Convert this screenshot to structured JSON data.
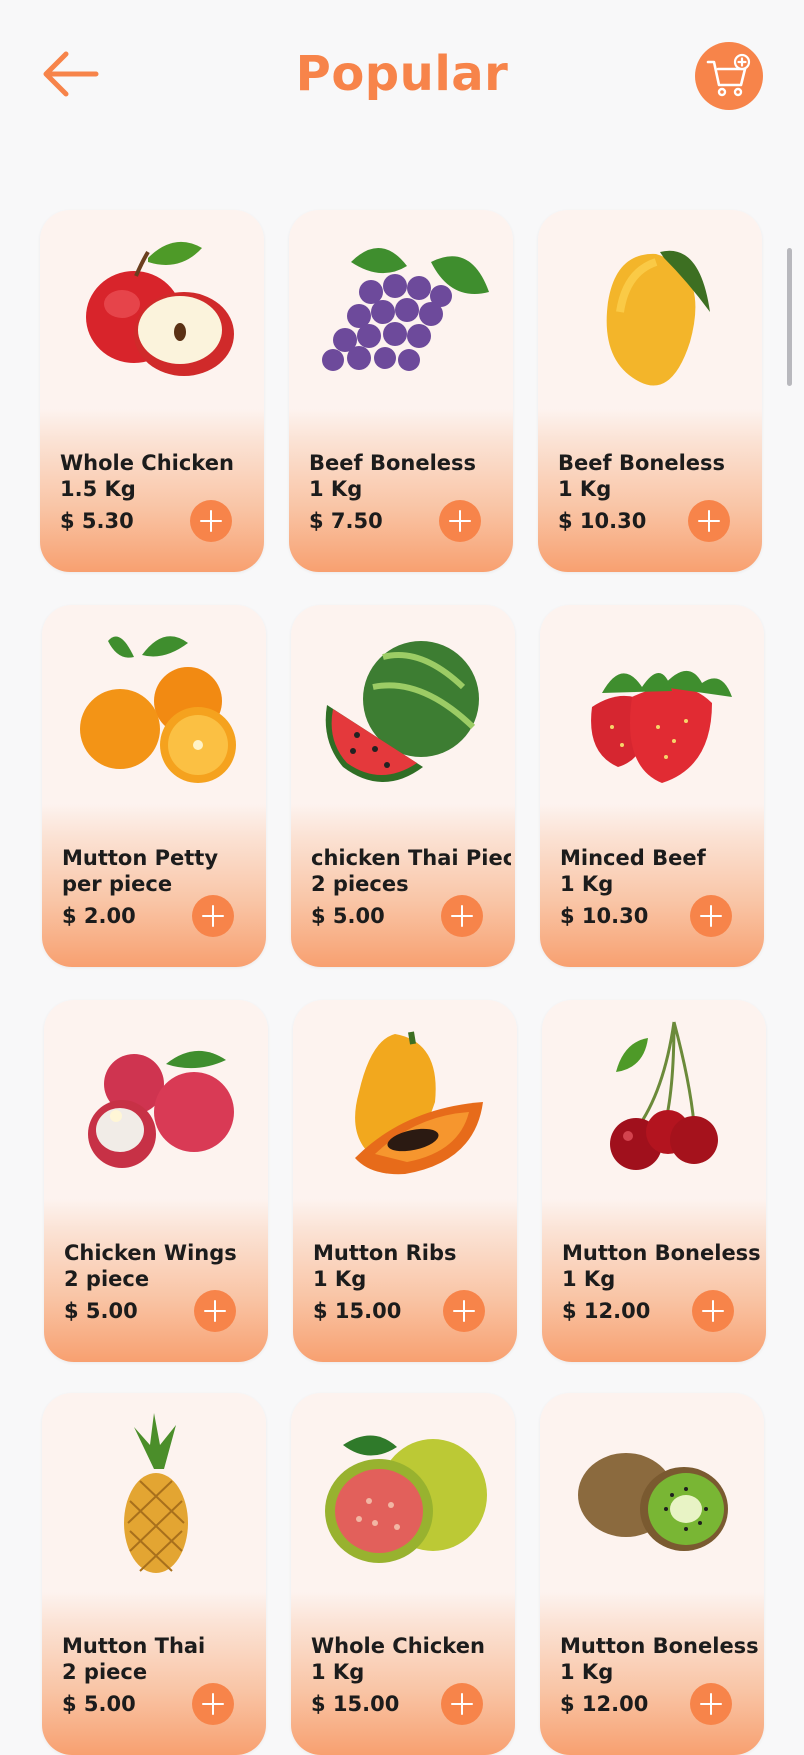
{
  "header": {
    "title": "Popular",
    "back_icon": "arrow-left-icon",
    "cart_icon": "cart-add-icon"
  },
  "colors": {
    "accent": "#f7844a",
    "card_bg": "#fdf3ef",
    "text": "#1c1c1c"
  },
  "products": [
    {
      "name": "Whole Chicken",
      "qty": "1.5 Kg",
      "price": "$ 5.30",
      "image": "apple"
    },
    {
      "name": "Beef Boneless",
      "qty": "1 Kg",
      "price": "$ 7.50",
      "image": "grapes"
    },
    {
      "name": "Beef Boneless",
      "qty": "1 Kg",
      "price": "$ 10.30",
      "image": "mango"
    },
    {
      "name": "Mutton Petty",
      "qty": "per piece",
      "price": "$ 2.00",
      "image": "oranges"
    },
    {
      "name": "chicken Thai Piece",
      "qty": "2 pieces",
      "price": "$ 5.00",
      "image": "watermelon"
    },
    {
      "name": "Minced Beef",
      "qty": "1 Kg",
      "price": "$ 10.30",
      "image": "strawberries"
    },
    {
      "name": "Chicken Wings",
      "qty": "2 piece",
      "price": "$ 5.00",
      "image": "lychee"
    },
    {
      "name": "Mutton Ribs",
      "qty": "1 Kg",
      "price": "$ 15.00",
      "image": "papaya"
    },
    {
      "name": "Mutton Boneless",
      "qty": "1 Kg",
      "price": "$ 12.00",
      "image": "cherries"
    },
    {
      "name": "Mutton Thai",
      "qty": "2 piece",
      "price": "$ 5.00",
      "image": "pineapple"
    },
    {
      "name": "Whole Chicken",
      "qty": "1 Kg",
      "price": "$ 15.00",
      "image": "guava"
    },
    {
      "name": "Mutton Boneless",
      "qty": "1 Kg",
      "price": "$ 12.00",
      "image": "kiwi"
    }
  ]
}
